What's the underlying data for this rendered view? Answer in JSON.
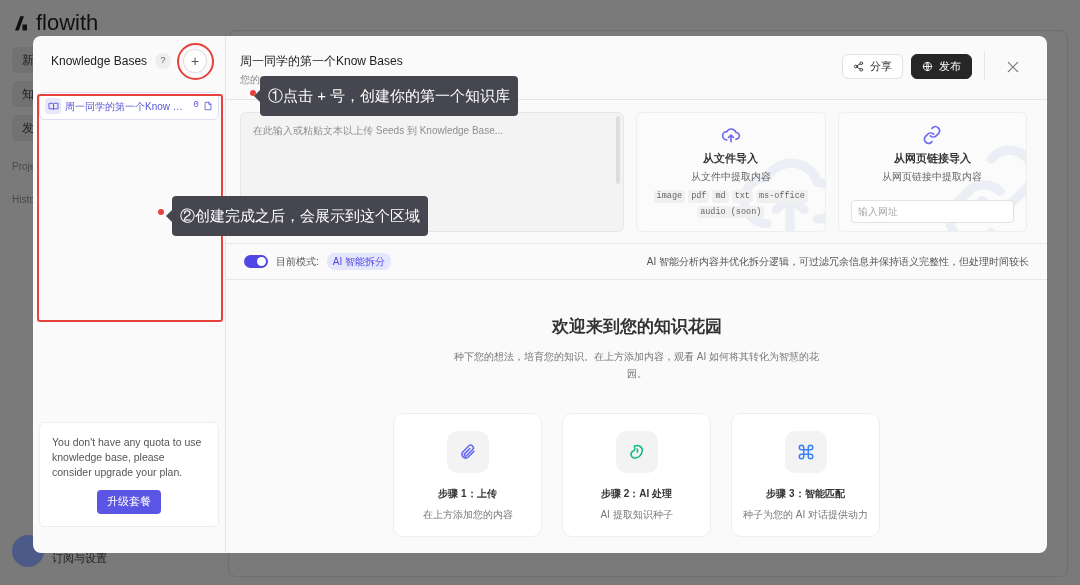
{
  "background_app": {
    "logo": "flowith",
    "nav_items": [
      "新",
      "知",
      "发"
    ],
    "sections": [
      "Proje",
      "Histo"
    ],
    "account_caption": "订阅与设置"
  },
  "sidebar": {
    "title": "Knowledge Bases",
    "help": "?",
    "add_button": "+",
    "items": [
      {
        "name": "周一同学的第一个Know …",
        "count": "0",
        "selected": true
      }
    ],
    "quota_notice": "You don't have any quota to use knowledge base, please consider upgrade your plan.",
    "upgrade_button": "升级套餐"
  },
  "main": {
    "title": "周一同学的第一个Know Bases",
    "subtitle": "您的",
    "buttons": [
      {
        "label": "分享",
        "kind": "share"
      },
      {
        "label": "发布",
        "kind": "publish"
      }
    ],
    "text_input": {
      "placeholder": "在此输入或粘贴文本以上传 Seeds 到 Knowledge Base..."
    },
    "import_cards": [
      {
        "kind": "file",
        "title": "从文件导入",
        "subtitle": "从文件中提取内容",
        "formats": [
          "image",
          "pdf",
          "md",
          "txt",
          "ms-office",
          "audio (soon)"
        ]
      },
      {
        "kind": "link",
        "title": "从网页链接导入",
        "subtitle": "从网页链接中提取内容",
        "url_placeholder": "输入网址"
      }
    ],
    "mode": {
      "on": true,
      "label": "目前模式:",
      "value": "AI 智能拆分",
      "description": "AI 智能分析内容并优化拆分逻辑，可过滤冗余信息并保持语义完整性，但处理时间较长"
    },
    "welcome": {
      "title": "欢迎来到您的知识花园",
      "text": "种下您的想法，培育您的知识。在上方添加内容，观看 AI 如何将其转化为智慧的花园。"
    },
    "steps": [
      {
        "kind": "upload",
        "title": "步骤 1：上传",
        "description": "在上方添加您的内容"
      },
      {
        "kind": "process",
        "title": "步骤 2：AI 处理",
        "description": "AI 提取知识种子"
      },
      {
        "kind": "match",
        "title": "步骤 3：智能匹配",
        "description": "种子为您的 AI 对话提供动力"
      }
    ]
  },
  "annotations": [
    {
      "text": "①点击 + 号，创建你的第一个知识库"
    },
    {
      "text": "②创建完成之后，会展示到这个区域"
    }
  ]
}
